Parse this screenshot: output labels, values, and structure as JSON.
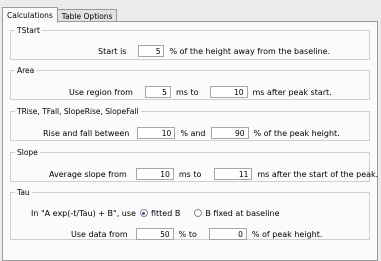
{
  "tabs": [
    {
      "label": "Calculations"
    },
    {
      "label": "Table Options"
    }
  ],
  "tstart": {
    "legend": "TStart",
    "label_before": "Start is",
    "value": "5",
    "label_after": "% of the height away from the baseline."
  },
  "area": {
    "legend": "Area",
    "label_before": "Use region from",
    "value_from": "5",
    "label_mid": "ms to",
    "value_to": "10",
    "label_after": "ms after peak start."
  },
  "rise": {
    "legend": "TRise, TFall, SlopeRise, SlopeFall",
    "label_before": "Rise and fall between",
    "value_from": "10",
    "label_mid": "% and",
    "value_to": "90",
    "label_after": "% of the peak height."
  },
  "slope": {
    "legend": "Slope",
    "label_before": "Average slope from",
    "value_from": "10",
    "label_mid": "ms to",
    "value_to": "11",
    "label_after": "ms after the start of the peak."
  },
  "tau": {
    "legend": "Tau",
    "formula_label": "In  \"A exp(-t/Tau) + B\", use",
    "radio_fitted": "fitted B",
    "radio_fixed": "B fixed at baseline",
    "selected": "fitted B",
    "label_before": "Use data from",
    "value_from": "50",
    "label_mid": "% to",
    "value_to": "0",
    "label_after": "% of peak height."
  }
}
